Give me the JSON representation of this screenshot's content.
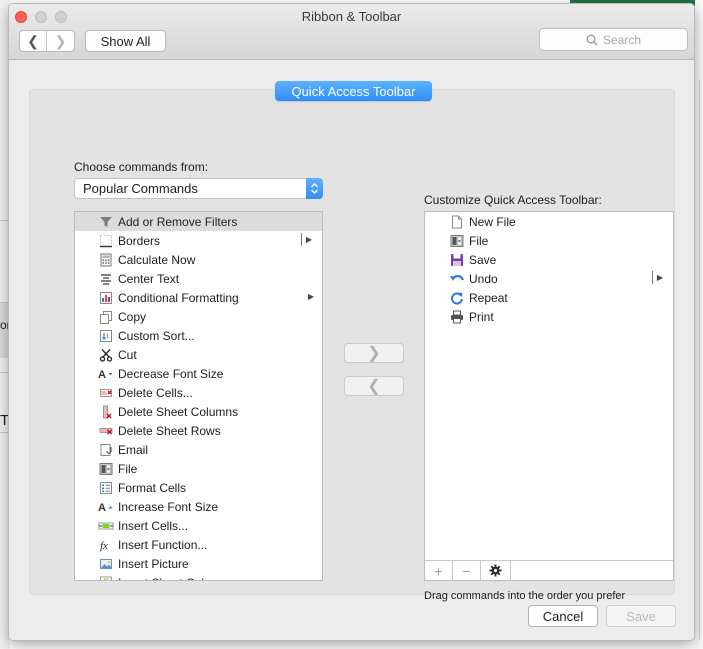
{
  "window": {
    "title": "Ribbon & Toolbar"
  },
  "toolbar": {
    "back_glyph": "❮",
    "forward_glyph": "❯",
    "show_all_label": "Show All",
    "search_placeholder": "Search"
  },
  "tab": {
    "label": "Quick Access Toolbar"
  },
  "left": {
    "choose_label": "Choose commands from:",
    "selected_source": "Popular Commands",
    "commands": [
      {
        "label": "Add or Remove Filters",
        "icon": "filter-icon",
        "selected": true,
        "submenu": false
      },
      {
        "label": "Borders",
        "icon": "borders-icon",
        "selected": false,
        "submenu": "bar"
      },
      {
        "label": "Calculate Now",
        "icon": "calculator-icon",
        "selected": false,
        "submenu": false
      },
      {
        "label": "Center Text",
        "icon": "center-text-icon",
        "selected": false,
        "submenu": false
      },
      {
        "label": "Conditional Formatting",
        "icon": "conditional-formatting-icon",
        "selected": false,
        "submenu": "plain"
      },
      {
        "label": "Copy",
        "icon": "copy-icon",
        "selected": false,
        "submenu": false
      },
      {
        "label": "Custom Sort...",
        "icon": "sort-icon",
        "selected": false,
        "submenu": false
      },
      {
        "label": "Cut",
        "icon": "scissors-icon",
        "selected": false,
        "submenu": false
      },
      {
        "label": "Decrease Font Size",
        "icon": "decrease-font-icon",
        "selected": false,
        "submenu": false
      },
      {
        "label": "Delete Cells...",
        "icon": "delete-cells-icon",
        "selected": false,
        "submenu": false
      },
      {
        "label": "Delete Sheet Columns",
        "icon": "delete-columns-icon",
        "selected": false,
        "submenu": false
      },
      {
        "label": "Delete Sheet Rows",
        "icon": "delete-rows-icon",
        "selected": false,
        "submenu": false
      },
      {
        "label": "Email",
        "icon": "email-icon",
        "selected": false,
        "submenu": false
      },
      {
        "label": "File",
        "icon": "file-menu-icon",
        "selected": false,
        "submenu": false
      },
      {
        "label": "Format Cells",
        "icon": "format-cells-icon",
        "selected": false,
        "submenu": false
      },
      {
        "label": "Increase Font Size",
        "icon": "increase-font-icon",
        "selected": false,
        "submenu": false
      },
      {
        "label": "Insert Cells...",
        "icon": "insert-cells-icon",
        "selected": false,
        "submenu": false
      },
      {
        "label": "Insert Function...",
        "icon": "function-icon",
        "selected": false,
        "submenu": false
      },
      {
        "label": "Insert Picture",
        "icon": "picture-icon",
        "selected": false,
        "submenu": false
      },
      {
        "label": "Insert Sheet Columns",
        "icon": "insert-columns-icon",
        "selected": false,
        "submenu": false
      }
    ]
  },
  "right": {
    "customize_label": "Customize Quick Access Toolbar:",
    "items": [
      {
        "label": "New File",
        "icon": "new-file-icon",
        "submenu": false
      },
      {
        "label": "File",
        "icon": "file-menu-icon",
        "submenu": false
      },
      {
        "label": "Save",
        "icon": "save-icon",
        "submenu": false
      },
      {
        "label": "Undo",
        "icon": "undo-icon",
        "submenu": "bar"
      },
      {
        "label": "Repeat",
        "icon": "repeat-icon",
        "submenu": false
      },
      {
        "label": "Print",
        "icon": "printer-icon",
        "submenu": false
      }
    ],
    "add_glyph": "+",
    "remove_glyph": "−",
    "hint": "Drag commands into the order you prefer"
  },
  "transfer": {
    "add_glyph": "❯",
    "remove_glyph": "❮"
  },
  "footer": {
    "cancel_label": "Cancel",
    "save_label": "Save"
  },
  "colors": {
    "accent": "#2d8ef7",
    "selection": "#dcdcdc"
  },
  "background": {
    "left_edge_chars": [
      "or",
      "T"
    ]
  }
}
